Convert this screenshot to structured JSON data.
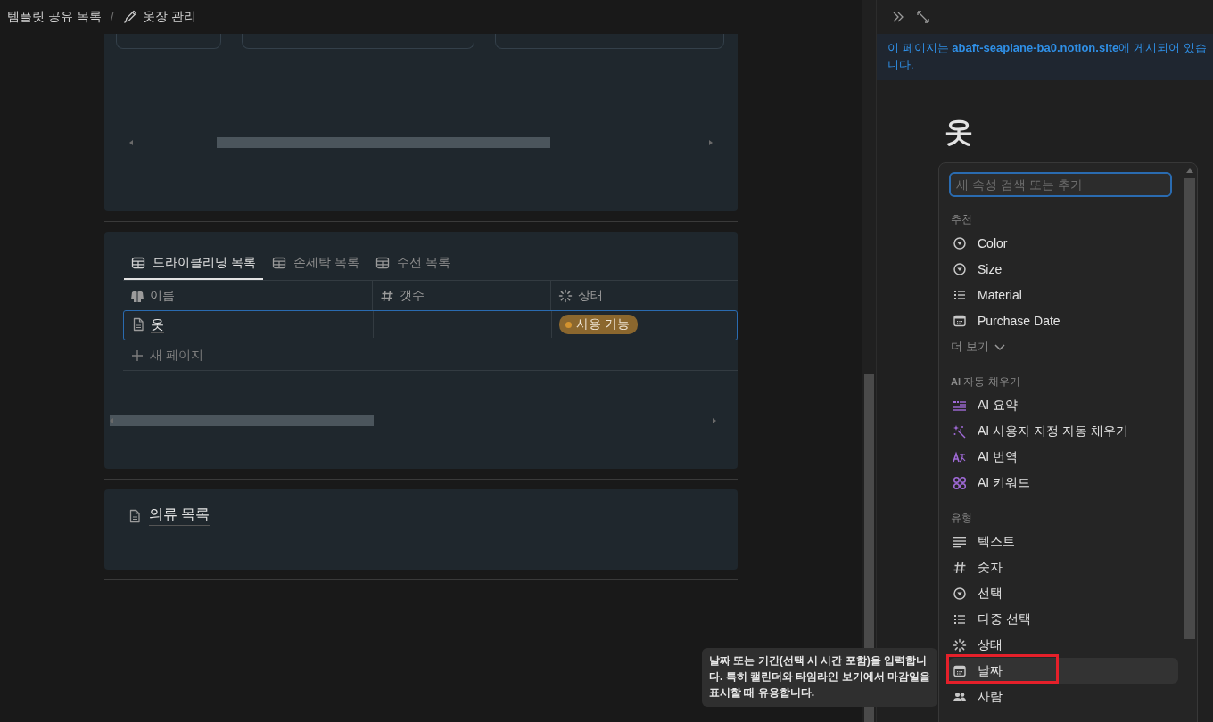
{
  "breadcrumb": {
    "items": [
      "템플릿 공유 목록",
      "옷장 관리"
    ],
    "separator": "/"
  },
  "database": {
    "tabs": [
      {
        "label": "드라이클리닝 목록",
        "selected": true
      },
      {
        "label": "손세탁 목록",
        "selected": false
      },
      {
        "label": "수선 목록",
        "selected": false
      }
    ],
    "columns": [
      {
        "label": "이름",
        "kind": "title"
      },
      {
        "label": "갯수",
        "kind": "number"
      },
      {
        "label": "상태",
        "kind": "status"
      }
    ],
    "rows": [
      {
        "name": "옷",
        "status": {
          "label": "사용 가능",
          "color": "#d3932f"
        },
        "selected": true
      }
    ],
    "new_row": "새 페이지"
  },
  "linked_page": {
    "title": "의류 목록"
  },
  "panel": {
    "banner": "이 페이지는 **abaft-seaplane-ba0.notion.site**에 게시되어 있습니다.",
    "title": "옷"
  },
  "menu": {
    "placeholder": "새 속성 검색 또는 추가",
    "sections": [
      {
        "title": "추천",
        "more": "더 보기",
        "items": [
          {
            "label": "Color",
            "kind": "select",
            "selected": false,
            "marked": false
          },
          {
            "label": "Size",
            "kind": "select",
            "selected": false,
            "marked": false
          },
          {
            "label": "Material",
            "kind": "multi",
            "selected": false,
            "marked": false
          },
          {
            "label": "Purchase Date",
            "kind": "date",
            "selected": false,
            "marked": false
          }
        ]
      },
      {
        "title": "**AI** 자동 채우기",
        "items": [
          {
            "label": "AI 요약",
            "kind": "ai-summary",
            "selected": false,
            "marked": false
          },
          {
            "label": "AI 사용자 지정 자동 채우기",
            "kind": "ai-autofill",
            "selected": false,
            "marked": false
          },
          {
            "label": "AI 번역",
            "kind": "ai-translate",
            "selected": false,
            "marked": false
          },
          {
            "label": "AI 키워드",
            "kind": "ai-keywords",
            "selected": false,
            "marked": false
          }
        ]
      },
      {
        "title": "유형",
        "items": [
          {
            "label": "텍스트",
            "kind": "text",
            "selected": false,
            "marked": false
          },
          {
            "label": "숫자",
            "kind": "number",
            "selected": false,
            "marked": false
          },
          {
            "label": "선택",
            "kind": "select",
            "selected": false,
            "marked": false
          },
          {
            "label": "다중 선택",
            "kind": "multi",
            "selected": false,
            "marked": false
          },
          {
            "label": "상태",
            "kind": "status",
            "selected": false,
            "marked": false
          },
          {
            "label": "날짜",
            "kind": "date",
            "selected": true,
            "marked": true
          },
          {
            "label": "사람",
            "kind": "person",
            "selected": false,
            "marked": false
          }
        ]
      }
    ]
  },
  "tooltip": "날짜 또는 기간(선택 시 시간 포함)을 입력합니다. 특히 캘린더와 타임라인 보기에서 마감일을 표시할 때 유용합니다."
}
